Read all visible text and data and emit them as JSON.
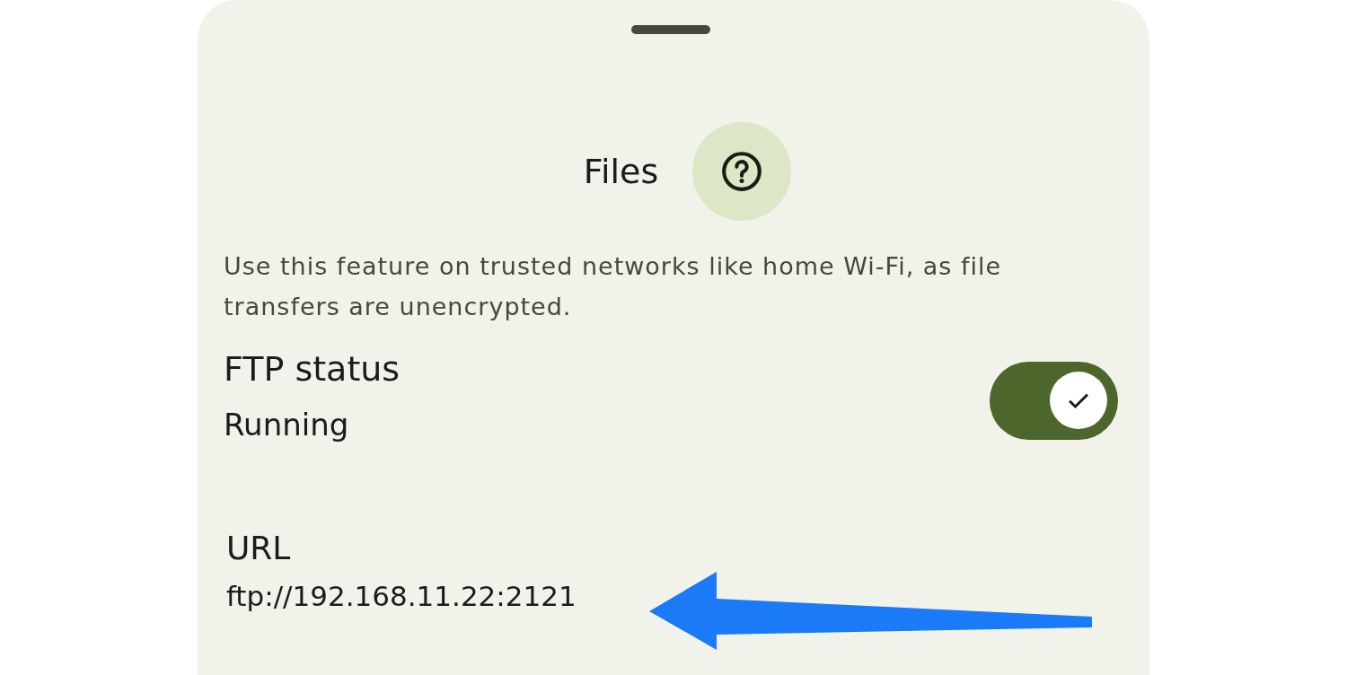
{
  "sheet": {
    "title": "Files",
    "description": "Use this feature on trusted networks like home Wi-Fi, as file transfers are unencrypted.",
    "settings": [
      {
        "kind": "toggle",
        "label": "FTP status",
        "value": "Running",
        "on": true
      },
      {
        "kind": "info",
        "label": "URL",
        "value": "ftp://192.168.11.22:2121"
      }
    ]
  }
}
